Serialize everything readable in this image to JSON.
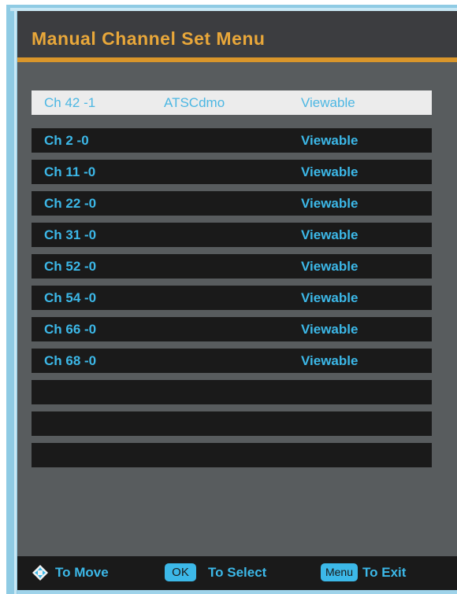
{
  "menu": {
    "title": "Manual Channel Set  Menu"
  },
  "channels": [
    {
      "channel": "Ch 42 -1",
      "type": "ATSCdmo",
      "status": "Viewable",
      "selected": true
    },
    {
      "channel": "Ch 2 -0",
      "type": "",
      "status": "Viewable",
      "selected": false
    },
    {
      "channel": "Ch 11 -0",
      "type": "",
      "status": "Viewable",
      "selected": false
    },
    {
      "channel": "Ch 22 -0",
      "type": "",
      "status": "Viewable",
      "selected": false
    },
    {
      "channel": "Ch 31 -0",
      "type": "",
      "status": "Viewable",
      "selected": false
    },
    {
      "channel": "Ch 52 -0",
      "type": "",
      "status": "Viewable",
      "selected": false
    },
    {
      "channel": "Ch 54 -0",
      "type": "",
      "status": "Viewable",
      "selected": false
    },
    {
      "channel": "Ch 66 -0",
      "type": "",
      "status": "Viewable",
      "selected": false
    },
    {
      "channel": "Ch 68 -0",
      "type": "",
      "status": "Viewable",
      "selected": false
    },
    {
      "channel": "",
      "type": "",
      "status": "",
      "selected": false
    },
    {
      "channel": "",
      "type": "",
      "status": "",
      "selected": false
    },
    {
      "channel": "",
      "type": "",
      "status": "",
      "selected": false
    }
  ],
  "footer": {
    "move_icon": "directional-pad-icon",
    "move_label": "To Move",
    "ok_key": "OK",
    "select_label": "To Select",
    "menu_key": "Menu",
    "exit_label": "To Exit"
  },
  "colors": {
    "accent": "#e8a73a",
    "highlight_text": "#3cb8e8",
    "panel": "#585c5e",
    "row_background": "#1a1a1a",
    "selected_row": "#ececec"
  }
}
